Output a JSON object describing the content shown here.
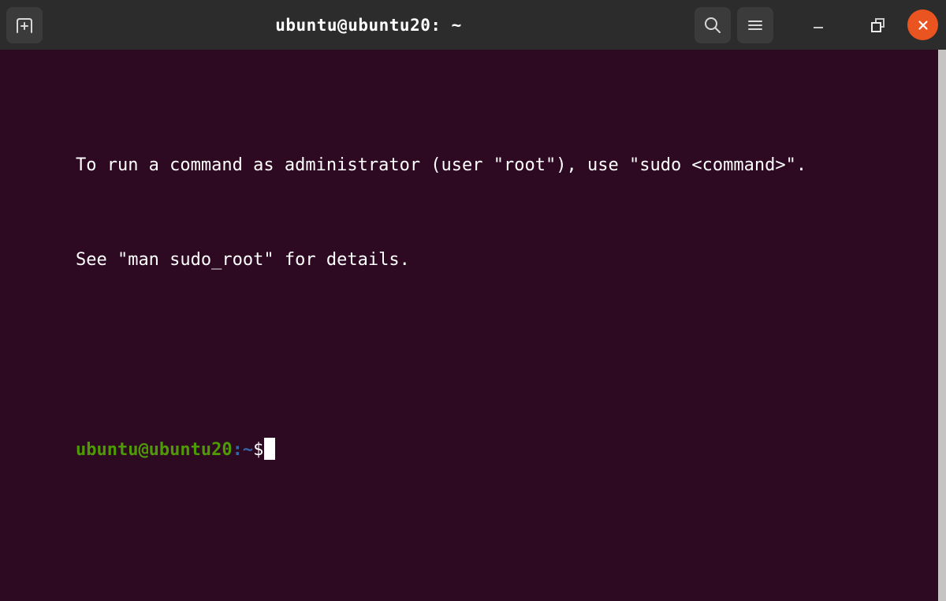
{
  "window": {
    "title": "ubuntu@ubuntu20: ~",
    "titlebar_bg": "#2c2c2c",
    "button_bg": "#3b3b3b",
    "close_color": "#e95420"
  },
  "titlebar": {
    "new_tab_label": "",
    "search_label": "",
    "menu_label": "",
    "minimize_label": "",
    "restore_label": "",
    "close_label": ""
  },
  "terminal": {
    "background": "#2d0922",
    "foreground": "#ffffff",
    "prompt_user_color": "#4e9a06",
    "prompt_path_color": "#3465a4",
    "lines": [
      "To run a command as administrator (user \"root\"), use \"sudo <command>\".",
      "See \"man sudo_root\" for details."
    ],
    "prompt": {
      "user_host": "ubuntu@ubuntu20",
      "separator": ":",
      "path": "~",
      "sigil": "$"
    }
  },
  "scrollbar": {
    "color": "#c6c4c2"
  }
}
